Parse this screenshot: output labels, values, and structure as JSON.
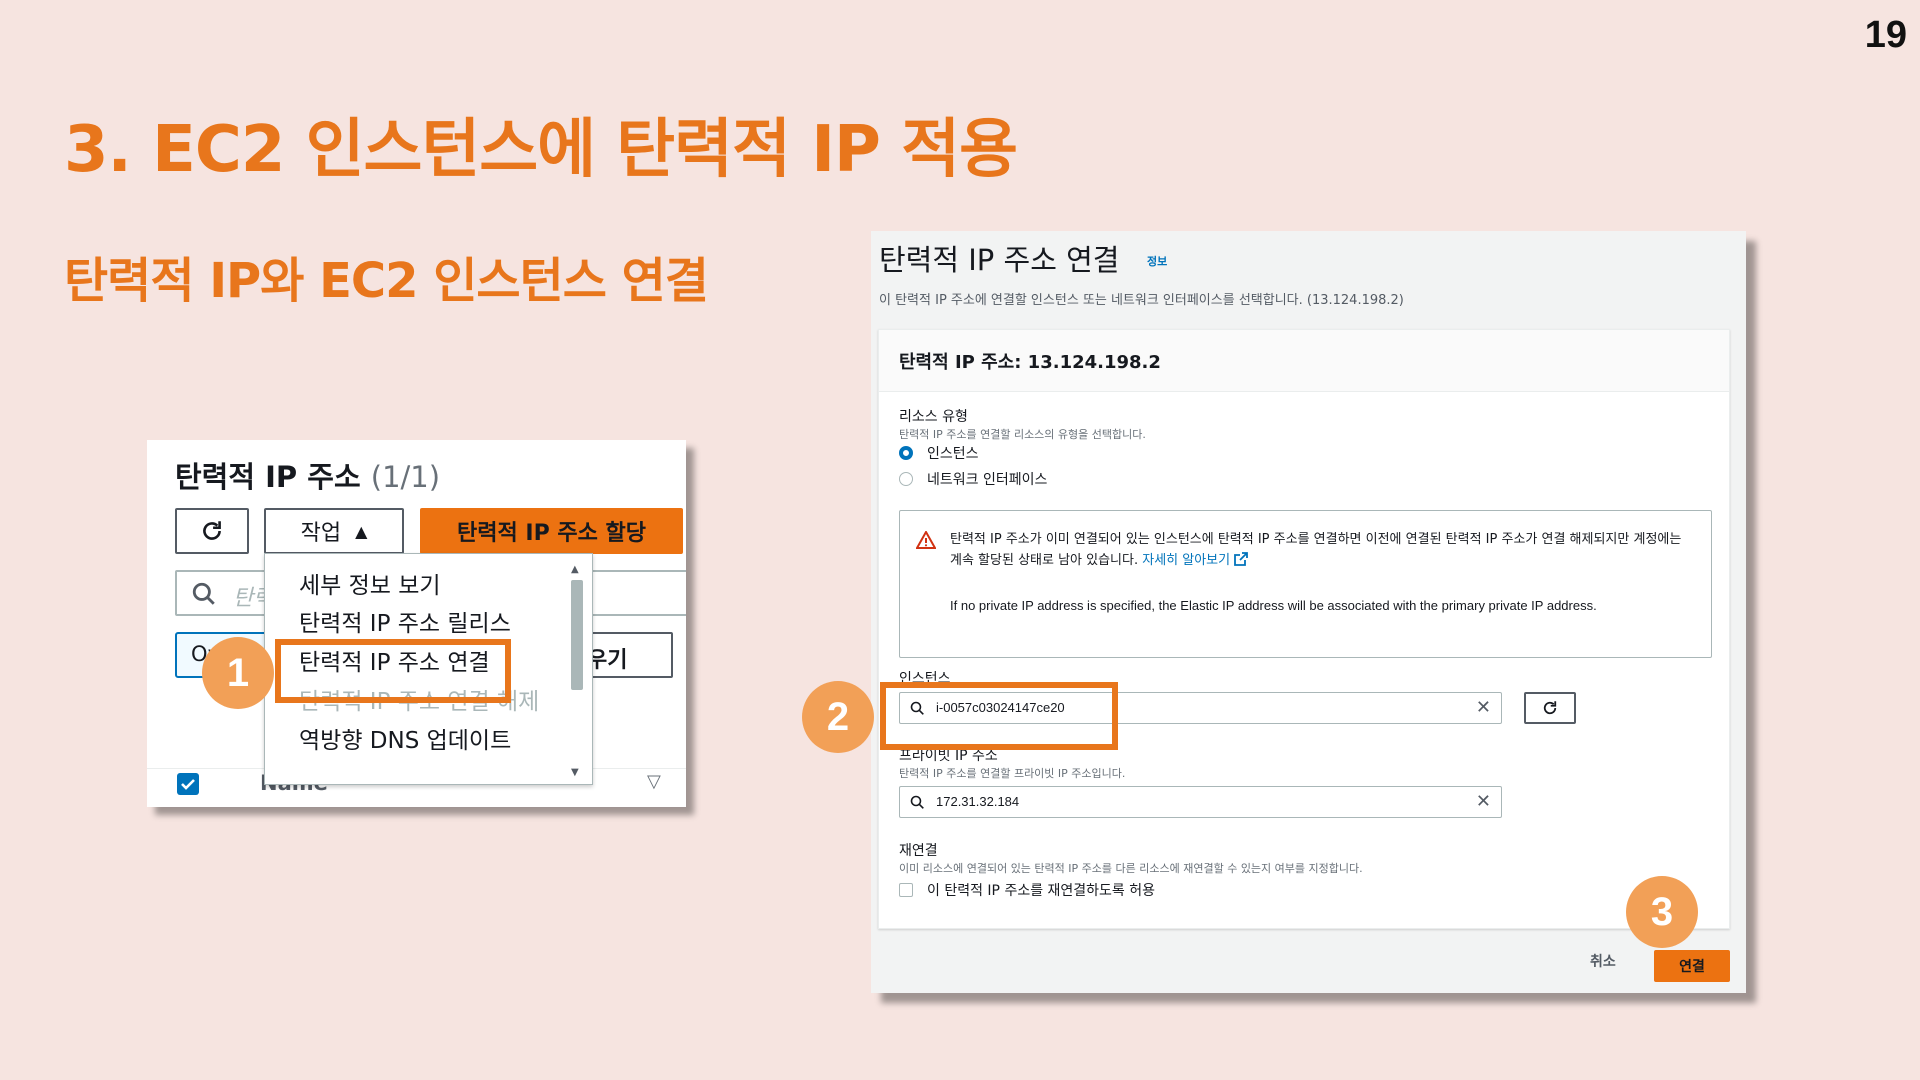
{
  "slide": {
    "page_number": "19",
    "title": "3. EC2 인스턴스에 탄력적 IP 적용",
    "subtitle": "탄력적 IP와 EC2 인스턴스 연결"
  },
  "left_panel": {
    "title": "탄력적 IP 주소",
    "count": "(1/1)",
    "actions_label": "작업",
    "allocate_label": "탄력적 IP 주소 할당",
    "search_placeholder": "탄력",
    "owner_chip": "Owner:",
    "clear_label": "우기",
    "menu_items": [
      {
        "label": "세부 정보 보기",
        "disabled": false
      },
      {
        "label": "탄력적 IP 주소 릴리스",
        "disabled": false
      },
      {
        "label": "탄력적 IP 주소 연결",
        "disabled": false
      },
      {
        "label": "탄력적 IP 주소 연결 해제",
        "disabled": true
      },
      {
        "label": "역방향 DNS 업데이트",
        "disabled": false
      }
    ],
    "column_name": "Name"
  },
  "steps": [
    "1",
    "2",
    "3"
  ],
  "dialog": {
    "title": "탄력적 IP 주소 연결",
    "info_link": "정보",
    "description": "이 탄력적 IP 주소에 연결할 인스턴스 또는 네트워크 인터페이스를 선택합니다. (13.124.198.2)",
    "card_header": "탄력적 IP 주소: 13.124.198.2",
    "resource_type_label": "리소스 유형",
    "resource_type_hint": "탄력적 IP 주소를 연결할 리소스의 유형을 선택합니다.",
    "resource_options": [
      "인스턴스",
      "네트워크 인터페이스"
    ],
    "selected_resource": "인스턴스",
    "alert_text": "탄력적 IP 주소가 이미 연결되어 있는 인스턴스에 탄력적 IP 주소를 연결하면 이전에 연결된 탄력적 IP 주소가 연결 해제되지만 계정에는 계속 할당된 상태로 남아 있습니다.",
    "alert_link": "자세히 알아보기",
    "alert_text_en": "If no private IP address is specified, the Elastic IP address will be associated with the primary private IP address.",
    "instance_label": "인스턴스",
    "instance_value": "i-0057c03024147ce20",
    "private_ip_label": "프라이빗 IP 주소",
    "private_ip_hint": "탄력적 IP 주소를 연결할 프라이빗 IP 주소입니다.",
    "private_ip_value": "172.31.32.184",
    "reassoc_label": "재연결",
    "reassoc_hint": "이미 리소스에 연결되어 있는 탄력적 IP 주소를 다른 리소스에 재연결할 수 있는지 여부를 지정합니다.",
    "reassoc_checkbox": "이 탄력적 IP 주소를 재연결하도록 허용",
    "cancel_label": "취소",
    "connect_label": "연결"
  },
  "colors": {
    "accent": "#e8761c",
    "aws_orange": "#ec7211",
    "link_blue": "#0073bb",
    "background": "#f6e4e0"
  }
}
